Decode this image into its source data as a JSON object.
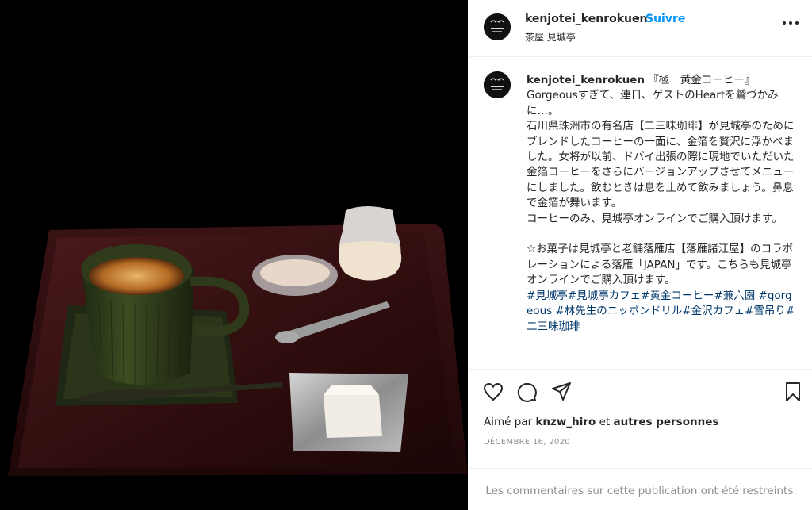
{
  "post": {
    "image_alt": "Gold leaf coffee with wagashi on lacquered tray"
  },
  "header": {
    "username": "kenjotei_kenrokuen",
    "separator": "•",
    "follow_label": "Suivre",
    "subtitle": "茶屋 見城亭",
    "more_label": "•••"
  },
  "avatar": {
    "logo_text": "KENJOTEI"
  },
  "caption": {
    "username": "kenjotei_kenrokuen",
    "line1": "『極　黄金コーヒー』",
    "line2": "Gorgeousすぎて、連日、ゲストのHeartを鷲づかみに…。",
    "para1": "石川県珠洲市の有名店【二三味珈琲】が見城亭のためにブレンドしたコーヒーの一面に、金箔を贅沢に浮かべました。女将が以前、ドバイ出張の際に現地でいただいた金箔コーヒーをさらにバージョンアップさせてメニューにしました。飲むときは息を止めて飲みましょう。鼻息で金箔が舞います。",
    "para2": "コーヒーのみ、見城亭オンラインでご購入頂けます。",
    "para3": "☆お菓子は見城亭と老舗落雁店【落雁諸江屋】のコラボレーションによる落雁「JAPAN」です。こちらも見城亭オンラインでご購入頂けます。",
    "tags": "#見城亭#見城亭カフェ#黄金コーヒー#兼六園 #gorgeous #林先生のニッポンドリル#金沢カフェ#雪吊り#二三味珈琲"
  },
  "actions": {
    "like_icon": "heart-icon",
    "comment_icon": "comment-icon",
    "share_icon": "share-icon",
    "save_icon": "bookmark-icon"
  },
  "likes": {
    "prefix": "Aimé par",
    "user": "knzw_hiro",
    "middle": "et",
    "suffix": "autres personnes"
  },
  "date": "DÉCEMBRE 16, 2020",
  "restricted_text": "Les commentaires sur cette publication ont été restreints."
}
